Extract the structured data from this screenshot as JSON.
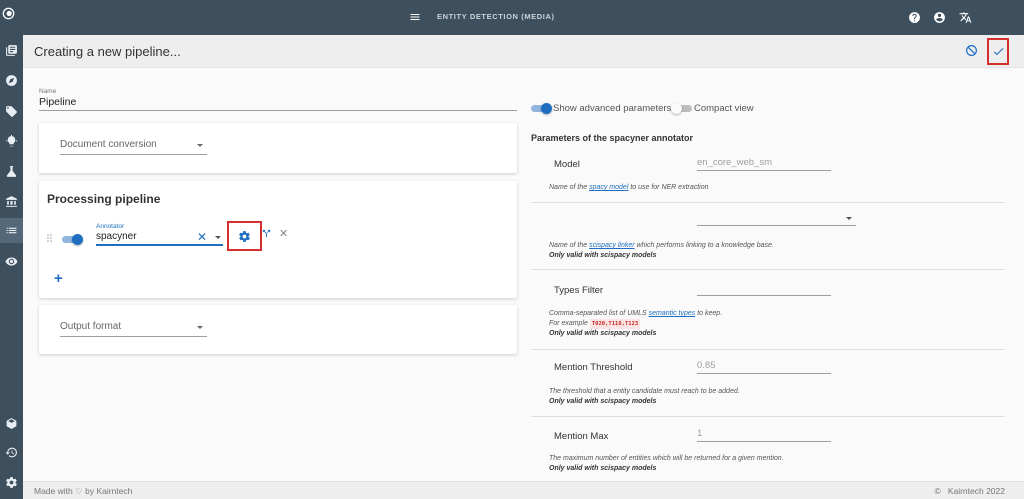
{
  "app": {
    "title": "ENTITY DETECTION (MEDIA)"
  },
  "header": {
    "page_title": "Creating a new pipeline..."
  },
  "form": {
    "name_label": "Name",
    "name_value": "Pipeline",
    "document_conversion_placeholder": "Document conversion",
    "processing_title": "Processing pipeline",
    "annotator_label": "Annotator",
    "annotator_value": "spacyner",
    "add_symbol": "+",
    "output_format_placeholder": "Output format"
  },
  "options": {
    "show_advanced_label": "Show advanced parameters",
    "show_advanced_on": true,
    "compact_view_label": "Compact view",
    "compact_view_on": false
  },
  "params": {
    "title": "Parameters of the spacyner annotator",
    "model": {
      "label": "Model",
      "value": "en_core_web_sm",
      "desc_pre": "Name of the ",
      "desc_link": "spacy model",
      "desc_post": " to use for NER extraction"
    },
    "linker": {
      "desc_pre": "Name of the ",
      "desc_link": "scispacy linker",
      "desc_post": " which performs linking to a knowledge base.",
      "note": "Only valid with scispacy models"
    },
    "types_filter": {
      "label": "Types Filter",
      "value": "",
      "desc_pre": "Comma-separated list of UMLS ",
      "desc_link": "semantic types",
      "desc_post": " to keep.",
      "example_label": "For example",
      "example_code": "T020,T116,T123",
      "note": "Only valid with scispacy models"
    },
    "mention_threshold": {
      "label": "Mention Threshold",
      "value": "0.85",
      "desc": "The threshold that a entity candidate must reach to be added.",
      "note": "Only valid with scispacy models"
    },
    "mention_max": {
      "label": "Mention Max",
      "value": "1",
      "desc": "The maximum number of entities which will be returned for a given mention.",
      "note": "Only valid with scispacy models"
    }
  },
  "footer": {
    "made_with_pre": "Made with",
    "heart": "♡",
    "made_with_post": "by Kairntech",
    "copyright_symbol": "©",
    "copyright_text": "Kairntech 2022"
  },
  "colors": {
    "accent": "#1e6fc2",
    "topbar": "#3e4f5d",
    "highlight_box": "#d32f2f"
  }
}
